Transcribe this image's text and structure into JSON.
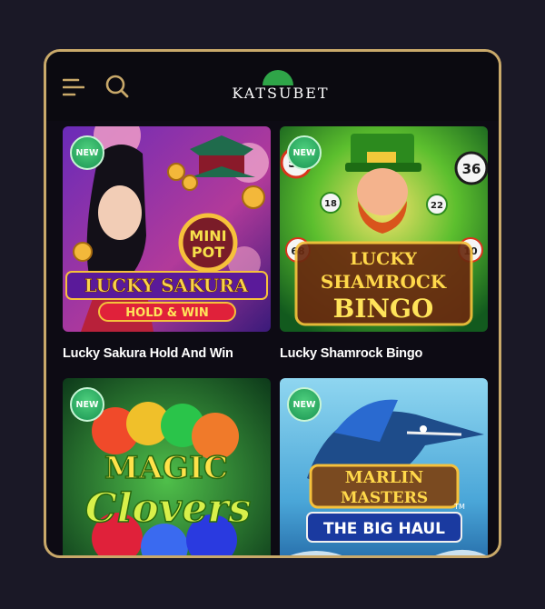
{
  "header": {
    "logo_text": "KATSUBET",
    "menu_icon": "hamburger-menu-icon",
    "search_icon": "search-icon"
  },
  "colors": {
    "frame_border": "#c9a96a",
    "background": "#0d0b14",
    "logo_green": "#2fa548",
    "badge_green": "#2ebd6a"
  },
  "games": [
    {
      "title": "Lucky Sakura Hold And Win",
      "badge": "NEW",
      "art_lines": [
        "MINI",
        "POT",
        "LUCKY SAKURA",
        "HOLD & WIN"
      ]
    },
    {
      "title": "Lucky Shamrock Bingo",
      "badge": "NEW",
      "art_lines": [
        "LUCKY",
        "SHAMROCK",
        "BINGO"
      ],
      "balls": [
        "5",
        "36",
        "18",
        "22",
        "68",
        "10"
      ]
    },
    {
      "title": "",
      "badge": "NEW",
      "art_lines": [
        "MAGIC",
        "Clovers"
      ]
    },
    {
      "title": "",
      "badge": "NEW",
      "art_lines": [
        "MARLIN",
        "MASTERS",
        "THE BIG HAUL",
        "TM"
      ]
    }
  ]
}
